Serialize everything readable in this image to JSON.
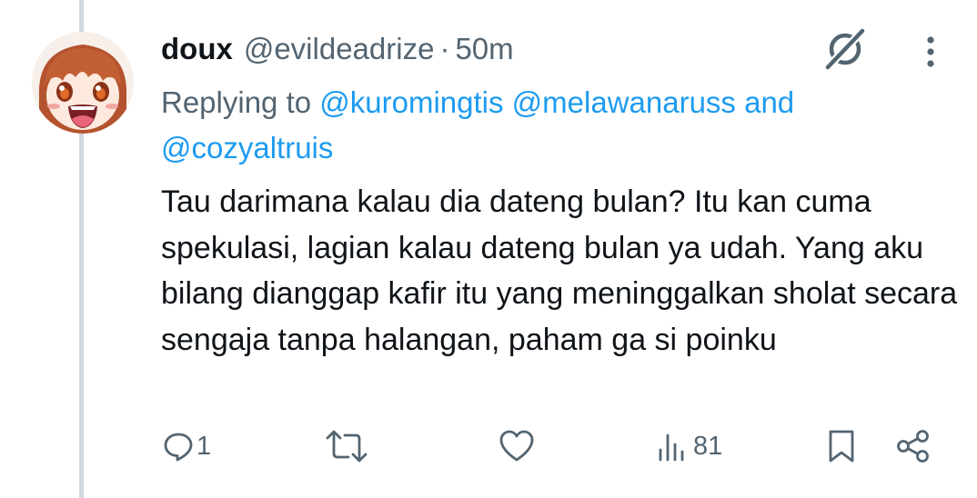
{
  "tweet": {
    "author_name": "doux",
    "author_handle": "@evildeadrize",
    "separator": "·",
    "time": "50m",
    "replying_prefix": "Replying to ",
    "mentions": [
      "@kuromingtis",
      "@melawanaruss"
    ],
    "mentions_joiner": " and",
    "last_mention": "@cozyaltruis",
    "text": "Tau darimana kalau dia dateng bulan? Itu kan cuma spekulasi, lagian kalau dateng bulan ya udah. Yang aku bilang dianggap kafir itu yang meninggalkan sholat secara sengaja tanpa halangan, paham ga si poinku"
  },
  "actions": {
    "reply_count": "1",
    "views_count": "81"
  },
  "icons": {
    "header": [
      "grok-icon",
      "more-options-icon"
    ],
    "actions": [
      "reply-icon",
      "retweet-icon",
      "like-icon",
      "views-icon",
      "bookmark-icon",
      "share-icon"
    ]
  },
  "colors": {
    "text": "#0f1419",
    "muted": "#536471",
    "link": "#1d9bf0",
    "thread_line": "#cfd9de"
  }
}
